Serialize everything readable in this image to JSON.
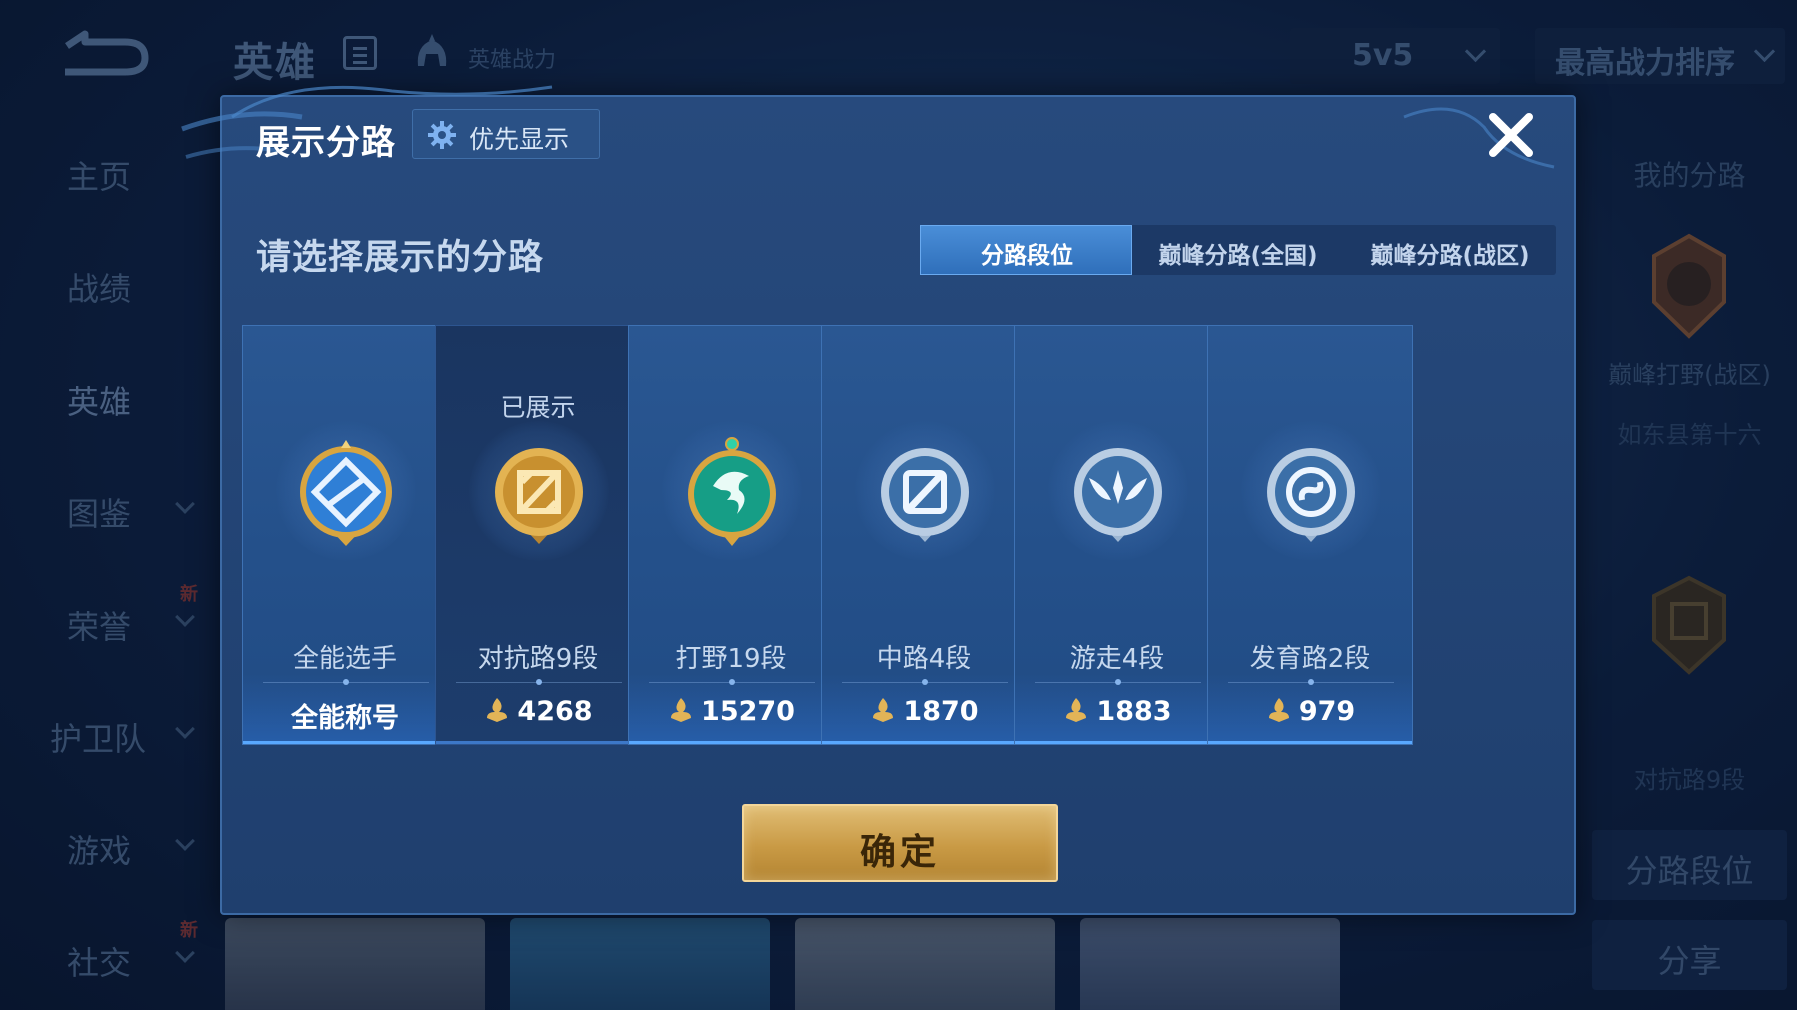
{
  "background": {
    "page_title": "英雄",
    "hero_power_label": "英雄战力",
    "mode_select": "5v5",
    "sort_select": "最高战力排序",
    "sidebar": [
      {
        "label": "主页",
        "has_dropdown": false,
        "is_new": false
      },
      {
        "label": "战绩",
        "has_dropdown": false,
        "is_new": false
      },
      {
        "label": "英雄",
        "has_dropdown": false,
        "is_new": false,
        "active": true
      },
      {
        "label": "图鉴",
        "has_dropdown": true,
        "is_new": false
      },
      {
        "label": "荣誉",
        "has_dropdown": true,
        "is_new": true
      },
      {
        "label": "护卫队",
        "has_dropdown": true,
        "is_new": false
      },
      {
        "label": "游戏",
        "has_dropdown": true,
        "is_new": false
      },
      {
        "label": "社交",
        "has_dropdown": true,
        "is_new": true
      }
    ],
    "new_badge_text": "新",
    "right_panel": {
      "title": "我的分路",
      "route_label": "巅峰打野(战区)",
      "region_label": "如东县第十六",
      "secondary_label": "对抗路9段",
      "route_rank_button": "分路段位",
      "share_button": "分享"
    }
  },
  "modal": {
    "title": "展示分路",
    "priority_button": "优先显示",
    "subtitle": "请选择展示的分路",
    "tabs": [
      {
        "label": "分路段位",
        "active": true
      },
      {
        "label": "巅峰分路(全国)",
        "active": false
      },
      {
        "label": "巅峰分路(战区)",
        "active": false
      }
    ],
    "cards": [
      {
        "name": "全能选手",
        "score": "全能称号",
        "shown": false,
        "has_flame": false,
        "icon": "all-round-badge-icon",
        "color": "#3d8fe0"
      },
      {
        "name": "对抗路9段",
        "score": "4268",
        "shown": true,
        "shown_label": "已展示",
        "has_flame": true,
        "icon": "clash-lane-badge-icon",
        "color": "#d9a640"
      },
      {
        "name": "打野19段",
        "score": "15270",
        "shown": false,
        "has_flame": true,
        "icon": "jungle-badge-icon",
        "color": "#1aa58a"
      },
      {
        "name": "中路4段",
        "score": "1870",
        "shown": false,
        "has_flame": true,
        "icon": "mid-lane-badge-icon",
        "color": "#8fb4d8"
      },
      {
        "name": "游走4段",
        "score": "1883",
        "shown": false,
        "has_flame": true,
        "icon": "roam-badge-icon",
        "color": "#8fb4d8"
      },
      {
        "name": "发育路2段",
        "score": "979",
        "shown": false,
        "has_flame": true,
        "icon": "farm-lane-badge-icon",
        "color": "#8fb4d8"
      }
    ],
    "confirm_button": "确定"
  },
  "colors": {
    "accent_blue": "#2f6fba",
    "confirm_gold": "#c99a45",
    "modal_bg": "#274a7d"
  }
}
